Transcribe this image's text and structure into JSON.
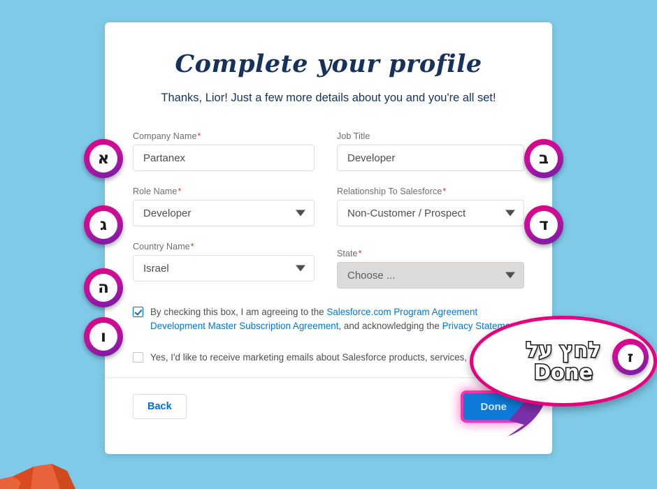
{
  "page": {
    "background_color": "#7ecae8",
    "card_background": "#ffffff"
  },
  "card": {
    "title": "Complete your profile",
    "subtitle": "Thanks, Lior! Just a few more details about you and you're all set!",
    "title_color": "#16325c"
  },
  "form": {
    "required_marker": "*",
    "fields": [
      {
        "label": "Company Name",
        "required": true,
        "type": "text",
        "value": "Partanex",
        "disabled": false
      },
      {
        "label": "Job Title",
        "required": false,
        "type": "text",
        "value": "Developer",
        "disabled": false
      },
      {
        "label": "Role Name",
        "required": true,
        "type": "select",
        "value": "Developer",
        "disabled": false
      },
      {
        "label": "Relationship To Salesforce",
        "required": true,
        "type": "select",
        "value": "Non-Customer / Prospect",
        "disabled": false
      },
      {
        "label": "Country Name",
        "required": true,
        "type": "select",
        "value": "Israel",
        "disabled": false
      },
      {
        "label": "State",
        "required": true,
        "type": "select",
        "value": "Choose ...",
        "disabled": true
      }
    ]
  },
  "consent": {
    "agreement": {
      "checked": true,
      "text_1": "By checking this box, I am agreeing to the ",
      "link_1": "Salesforce.com Program Agreement",
      "text_2": " ",
      "link_2": "Development Master Subscription Agreement",
      "text_3": ", and acknowledging the ",
      "link_3": "Privacy Statement",
      "required_marker": "*"
    },
    "marketing": {
      "checked": false,
      "text": "Yes, I'd like to receive marketing emails about Salesforce products, services, and events."
    },
    "link_color": "#0176d3"
  },
  "footer": {
    "back_label": "Back",
    "done_label": "Done",
    "done_color": "#0d7ad9",
    "highlight_color": "#ff2fb0"
  },
  "annotations": {
    "badges": [
      {
        "id": "1",
        "glyph": "א"
      },
      {
        "id": "2",
        "glyph": "ב"
      },
      {
        "id": "3",
        "glyph": "ג"
      },
      {
        "id": "4",
        "glyph": "ד"
      },
      {
        "id": "5",
        "glyph": "ה"
      },
      {
        "id": "6",
        "glyph": "ו"
      },
      {
        "id": "7",
        "glyph": "ז"
      }
    ],
    "callout": {
      "line_1": "לחץ על",
      "line_2": "Done",
      "border_color": "#e6007e"
    }
  }
}
